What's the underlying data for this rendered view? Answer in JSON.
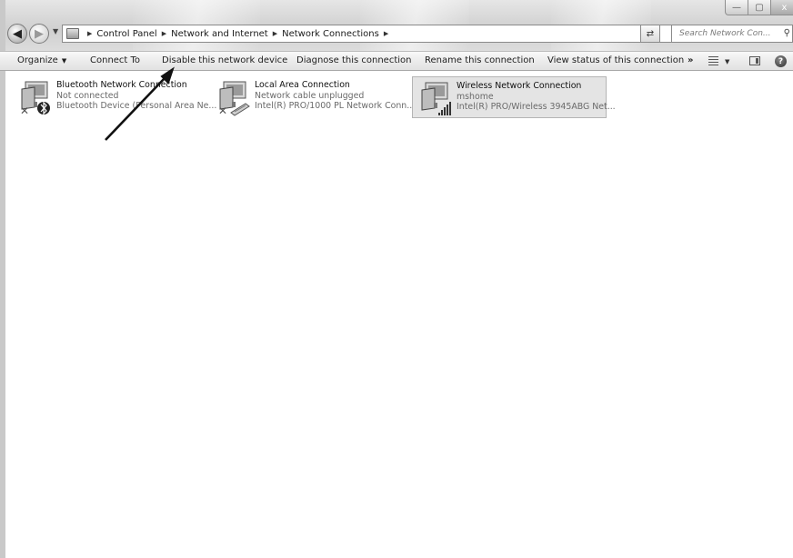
{
  "window": {
    "caption_buttons": {
      "minimize": "—",
      "maximize": "▢",
      "close": "x"
    }
  },
  "address_bar": {
    "breadcrumbs": [
      "Control Panel",
      "Network and Internet",
      "Network Connections"
    ],
    "search_placeholder": "Search Network Con..."
  },
  "command_bar": {
    "organize": "Organize",
    "connect_to": "Connect To",
    "disable": "Disable this network device",
    "diagnose": "Diagnose this connection",
    "rename": "Rename this connection",
    "view_status": "View status of this connection",
    "more": "»",
    "help": "?"
  },
  "connections": [
    {
      "name": "Bluetooth Network Connection",
      "status": "Not connected",
      "device": "Bluetooth Device (Personal Area Ne...",
      "icon": "bluetooth-network-icon",
      "badge": "disconnected-x-icon",
      "selected": false
    },
    {
      "name": "Local Area Connection",
      "status": "Network cable unplugged",
      "device": "Intel(R) PRO/1000 PL Network Conn...",
      "icon": "ethernet-network-icon",
      "badge": "disconnected-x-icon",
      "selected": false
    },
    {
      "name": "Wireless Network Connection",
      "status": "mshome",
      "device": "Intel(R) PRO/Wireless 3945ABG Net...",
      "icon": "wireless-network-icon",
      "badge": "signal-bars-icon",
      "selected": true
    }
  ],
  "colors": {
    "selection_background": "#e4e4e4",
    "secondary_text": "#6a6a6a",
    "annotation_arrow": "#111111"
  }
}
